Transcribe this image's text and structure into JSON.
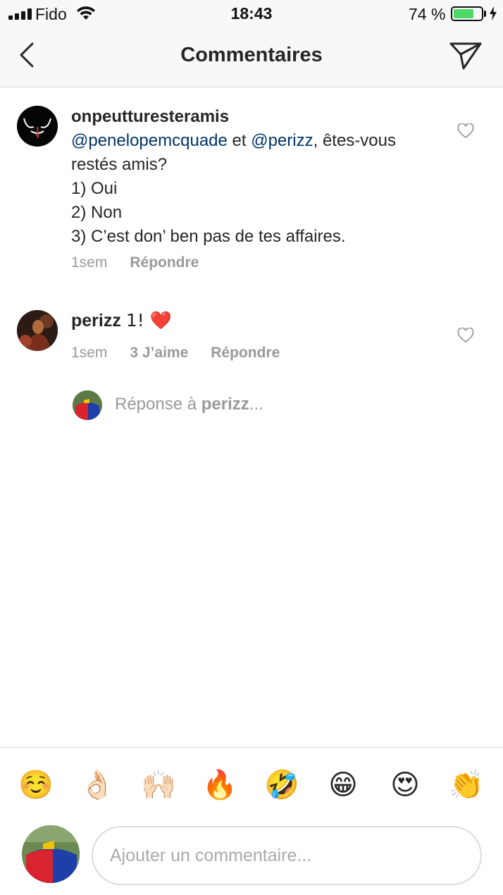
{
  "status_bar": {
    "carrier": "Fido",
    "time": "18:43",
    "battery_percent": "74 %",
    "battery_level": 0.74
  },
  "header": {
    "title": "Commentaires",
    "back_icon": "chevron-left-icon",
    "send_icon": "paper-plane-icon"
  },
  "comments": [
    {
      "username": "onpeutturesteramis",
      "mention_1": "@penelopemcquade",
      "connector": " et ",
      "mention_2": "@perizz",
      "text_rest": ", êtes-vous restés amis?",
      "lines": [
        "1) Oui",
        "2) Non",
        "3) C’est don’ ben pas de tes affaires."
      ],
      "time": "1sem",
      "reply_label": "Répondre"
    },
    {
      "username": "perizz",
      "text": "1! ❤️",
      "time": "1sem",
      "likes_label": "3 J’aime",
      "reply_label": "Répondre"
    }
  ],
  "reply_prompt": {
    "prefix": "Réponse à ",
    "user": "perizz",
    "suffix": "..."
  },
  "emoji_bar": [
    "☺️",
    "👌🏻",
    "🙌🏻",
    "🔥",
    "🤣",
    "😁",
    "😍",
    "👏"
  ],
  "comment_input": {
    "placeholder": "Ajouter un commentaire..."
  },
  "colors": {
    "mention": "#003569",
    "meta": "#999999",
    "battery": "#4cd964",
    "border": "#dbdbdb"
  }
}
